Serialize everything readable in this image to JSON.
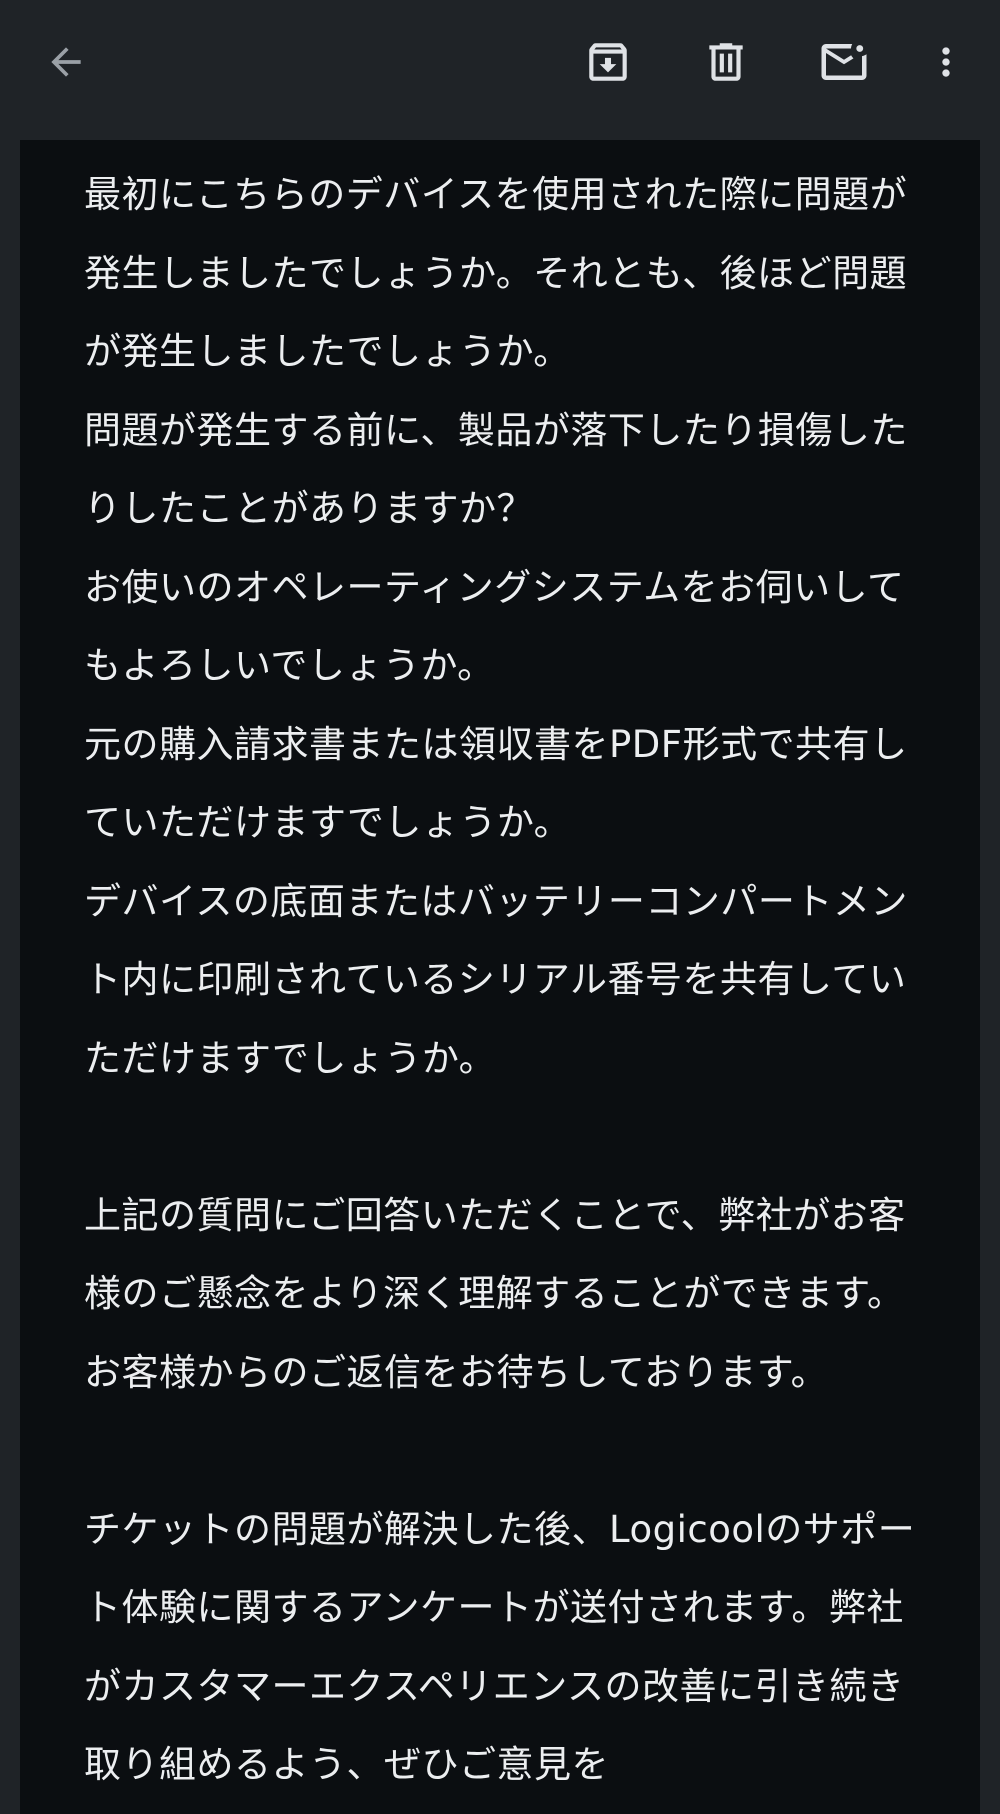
{
  "toolbar": {
    "back_icon": "arrow-back-icon",
    "archive_icon": "archive-icon",
    "delete_icon": "trash-icon",
    "mark_unread_icon": "mail-unread-icon",
    "more_icon": "more-vert-icon"
  },
  "colors": {
    "app_bar_bg": "#1f2327",
    "content_bg": "#0b0e11",
    "text": "#eceef0",
    "icon": "#dfe2e6"
  },
  "email": {
    "paragraphs": [
      "最初にこちらのデバイスを使用された際に問題が発生しましたでしょうか。それとも、後ほど問題が発生しましたでしょうか。",
      "問題が発生する前に、製品が落下したり損傷したりしたことがありますか？",
      "お使いのオペレーティングシステムをお伺いしてもよろしいでしょうか。",
      "元の購入請求書または領収書をPDF形式で共有していただけますでしょうか。",
      "デバイスの底面またはバッテリーコンパートメント内に印刷されているシリアル番号を共有していただけますでしょうか。",
      "上記の質問にご回答いただくことで、弊社がお客様のご懸念をより深く理解することができます。お客様からのご返信をお待ちしております。",
      "チケットの問題が解決した後、Logicoolのサポート体験に関するアンケートが送付されます。弊社がカスタマーエクスペリエンスの改善に引き続き取り組めるよう、ぜひご意見を"
    ]
  }
}
